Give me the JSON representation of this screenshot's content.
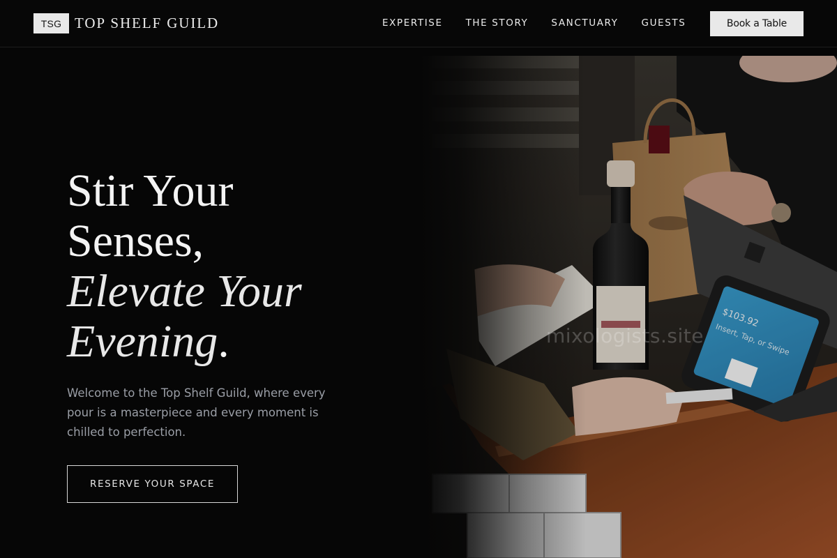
{
  "brand": {
    "badge": "TSG",
    "name": "TOP SHELF GUILD"
  },
  "nav": {
    "items": [
      {
        "label": "EXPERTISE"
      },
      {
        "label": "THE STORY"
      },
      {
        "label": "SANCTUARY"
      },
      {
        "label": "GUESTS"
      }
    ],
    "cta_label": "Book a Table"
  },
  "hero": {
    "title_line_1": "Stir Your",
    "title_line_2": "Senses,",
    "title_line_3": "Elevate Your",
    "title_line_4": "Evening",
    "title_period": ".",
    "lead": "Welcome to the Top Shelf Guild, where every pour is a masterpiece and every moment is chilled to perfection.",
    "reserve_label": "RESERVE YOUR SPACE"
  },
  "photo": {
    "terminal_amount": "$103.92",
    "terminal_prompt": "Insert, Tap, or Swipe",
    "watermark": "mixologists.site"
  },
  "colors": {
    "background": "#060606",
    "text": "#f4f4f4",
    "muted_text": "#9a9ea6",
    "button_fill": "#e9e9e9",
    "terminal_screen": "#2f8fc2",
    "counter_wood": "#6b3417"
  }
}
